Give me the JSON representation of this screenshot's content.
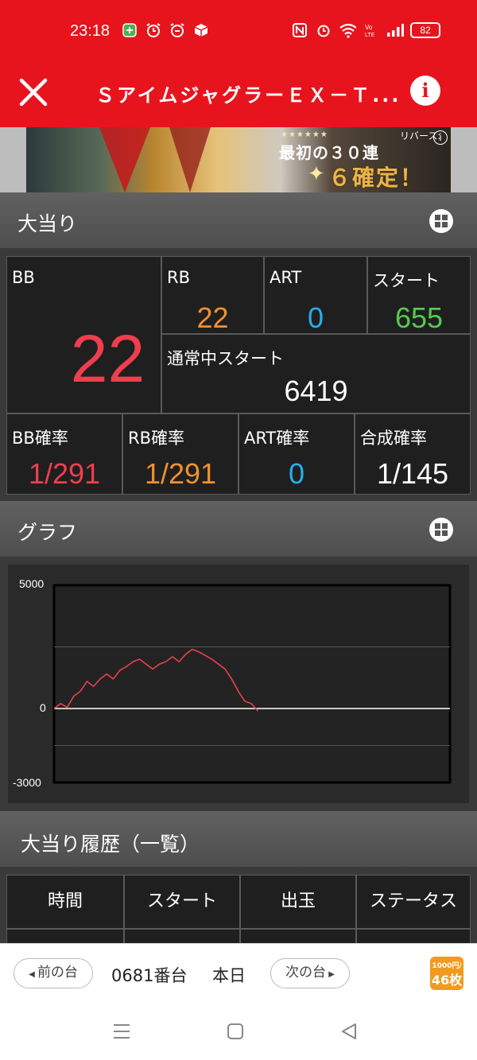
{
  "status_bar": {
    "time": "23:18",
    "battery": "82"
  },
  "app_bar": {
    "title": "ＳアイムジャグラーＥＸ－Ｔ..."
  },
  "banner": {
    "stars": "★★★★★★",
    "logo": "リバース:",
    "line1": "最初の３０連",
    "line2": "６確定！"
  },
  "jackpot": {
    "title": "大当り",
    "bb": {
      "label": "BB",
      "value": "22"
    },
    "rb": {
      "label": "RB",
      "value": "22"
    },
    "art": {
      "label": "ART",
      "value": "0"
    },
    "start": {
      "label": "スタート",
      "value": "655"
    },
    "normal_start": {
      "label": "通常中スタート",
      "value": "6419"
    },
    "bb_prob": {
      "label": "BB確率",
      "value": "1/291"
    },
    "rb_prob": {
      "label": "RB確率",
      "value": "1/291"
    },
    "art_prob": {
      "label": "ART確率",
      "value": "0"
    },
    "combined_prob": {
      "label": "合成確率",
      "value": "1/145"
    }
  },
  "graph": {
    "title": "グラフ"
  },
  "chart_data": {
    "type": "line",
    "ylim": [
      -3000,
      5000
    ],
    "y_ticks": [
      "5000",
      "0",
      "-3000"
    ],
    "series": [
      {
        "color": "#e8414d",
        "values": [
          0,
          200,
          50,
          500,
          700,
          1100,
          900,
          1200,
          1400,
          1200,
          1550,
          1700,
          1900,
          2000,
          1800,
          1600,
          1800,
          1900,
          2100,
          1900,
          2200,
          2400,
          2300,
          2150,
          2000,
          1800,
          1600,
          1200,
          700,
          300,
          200,
          -100
        ]
      }
    ],
    "colors": {
      "line": "#e8414d",
      "zero_line": "#ffffff",
      "grid": "#555555"
    }
  },
  "history": {
    "title": "大当り履歴（一覧）",
    "columns": [
      "時間",
      "スタート",
      "出玉",
      "ステータス"
    ]
  },
  "bottom_bar": {
    "prev": "前の台",
    "next": "次の台",
    "machine": "0681番台",
    "day": "本日",
    "rate_top": "1000円/",
    "rate_bottom": "46枚"
  },
  "colors": {
    "brand_red": "#e8141d",
    "red": "#ef3e4e",
    "orange": "#f1902f",
    "blue": "#27aee8",
    "green": "#55c951",
    "accent_orange": "#f39a1e"
  },
  "icons": [
    "close-icon",
    "info-icon",
    "grid-icon",
    "menu-icon",
    "home-icon",
    "back-icon"
  ]
}
